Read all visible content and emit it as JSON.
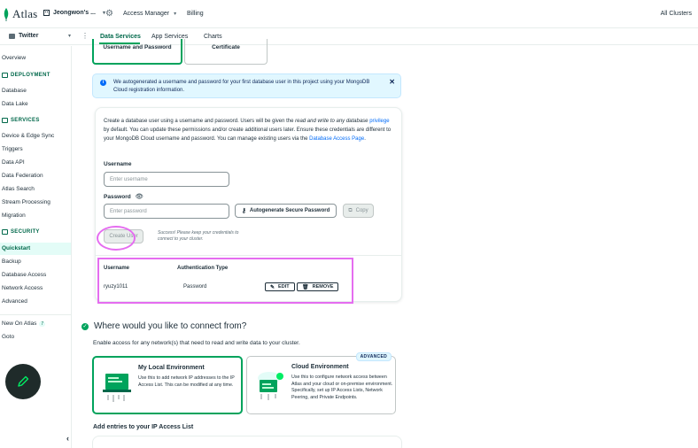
{
  "topbar": {
    "brand": "Atlas",
    "org_name": "Jeongwon's ...",
    "access_manager": "Access Manager",
    "billing": "Billing",
    "all_clusters": "All Clusters"
  },
  "projectbar": {
    "project_name": "Twitter",
    "tabs": [
      "Data Services",
      "App Services",
      "Charts"
    ]
  },
  "sidebar": {
    "overview": "Overview",
    "deployment": {
      "title": "DEPLOYMENT",
      "items": [
        "Database",
        "Data Lake"
      ]
    },
    "services": {
      "title": "SERVICES",
      "items": [
        "Device & Edge Sync",
        "Triggers",
        "Data API",
        "Data Federation",
        "Atlas Search",
        "Stream Processing",
        "Migration"
      ]
    },
    "security": {
      "title": "SECURITY",
      "items": [
        "Quickstart",
        "Backup",
        "Database Access",
        "Network Access",
        "Advanced"
      ]
    },
    "new_on_atlas": "New On Atlas",
    "new_count": "7",
    "goto": "Goto"
  },
  "auth_tabs": [
    "Username and Password",
    "Certificate"
  ],
  "banner": {
    "text": "We autogenerated a username and password for your first database user in this project using your MongoDB Cloud registration information."
  },
  "create_user": {
    "desc_1": "Create a database user using a username and password. Users will be given the ",
    "desc_em": "read and write to any database",
    "desc_link1": "privilege",
    "desc_2": " by default. You can update these permissions and/or create additional users later. Ensure these credentials are different to your MongoDB Cloud username and password. You can manage existing users via the ",
    "desc_link2": "Database Access Page",
    "desc_3": ".",
    "username_label": "Username",
    "username_placeholder": "Enter username",
    "password_label": "Password",
    "password_placeholder": "Enter password",
    "autogen_label": "Autogenerate Secure Password",
    "copy_label": "Copy",
    "create_label": "Create User",
    "success_text": "Success! Please keep your credentials to connect to your cluster."
  },
  "users_table": {
    "headers": [
      "Username",
      "Authentication Type"
    ],
    "rows": [
      {
        "username": "ryuzy1011",
        "auth": "Password",
        "edit": "EDIT",
        "remove": "REMOVE"
      }
    ]
  },
  "connect": {
    "title": "Where would you like to connect from?",
    "subtitle": "Enable access for any network(s) that need to read and write data to your cluster.",
    "local": {
      "title": "My Local Environment",
      "body": "Use this to add network IP addresses to the IP Access List. This can be modified at any time."
    },
    "cloud": {
      "badge": "ADVANCED",
      "title": "Cloud Environment",
      "body": "Use this to configure network access between Atlas and your cloud or on-premise environment. Specifically, set up IP Access Lists, Network Peering, and Private Endpoints."
    },
    "ip_title": "Add entries to your IP Access List"
  },
  "colors": {
    "accent": "#00a35c",
    "accent_dark": "#00684a",
    "link": "#016bf8",
    "annotation": "#e56df0"
  }
}
